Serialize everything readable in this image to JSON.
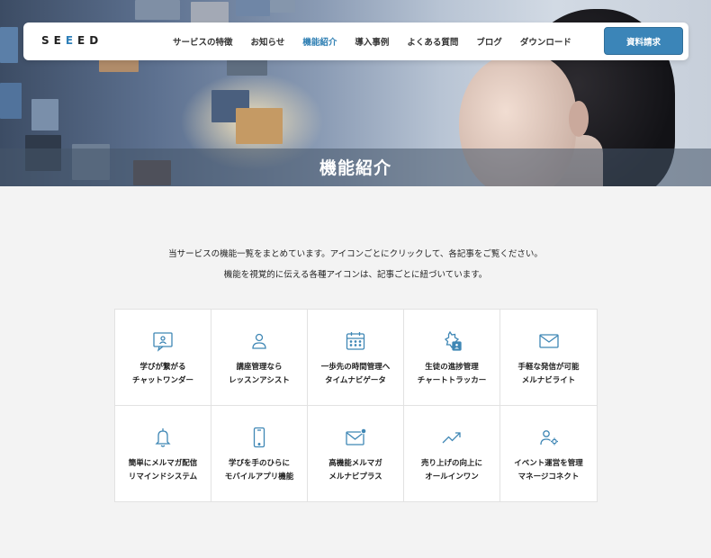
{
  "header": {
    "logo": {
      "pre": "SE",
      "accent": "E",
      "post": "ED"
    },
    "nav": [
      {
        "label": "サービスの特徴"
      },
      {
        "label": "お知らせ"
      },
      {
        "label": "機能紹介"
      },
      {
        "label": "導入事例"
      },
      {
        "label": "よくある質問"
      },
      {
        "label": "ブログ"
      },
      {
        "label": "ダウンロード"
      }
    ],
    "active_nav": "機能紹介",
    "cta_label": "資料請求"
  },
  "hero": {
    "title": "機能紹介"
  },
  "intro": {
    "line1": "当サービスの機能一覧をまとめています。アイコンごとにクリックして、各記事をご覧ください。",
    "line2": "機能を視覚的に伝える各種アイコンは、記事ごとに紐づいています。"
  },
  "features": [
    {
      "line1": "学びが繋がる",
      "line2": "チャットワンダー",
      "icon": "chat-user-icon"
    },
    {
      "line1": "講座管理なら",
      "line2": "レッスンアシスト",
      "icon": "user-icon"
    },
    {
      "line1": "一歩先の時間管理へ",
      "line2": "タイムナビゲータ",
      "icon": "calendar-icon"
    },
    {
      "line1": "生徒の進捗管理",
      "line2": "チャートトラッカー",
      "icon": "progress-badge-icon"
    },
    {
      "line1": "手軽な発信が可能",
      "line2": "メルナビライト",
      "icon": "mail-icon"
    },
    {
      "line1": "簡単にメルマガ配信",
      "line2": "リマインドシステム",
      "icon": "bell-icon"
    },
    {
      "line1": "学びを手のひらに",
      "line2": "モバイルアプリ機能",
      "icon": "smartphone-icon"
    },
    {
      "line1": "高機能メルマガ",
      "line2": "メルナビプラス",
      "icon": "mail-notification-icon"
    },
    {
      "line1": "売り上げの向上に",
      "line2": "オールインワン",
      "icon": "trending-up-icon"
    },
    {
      "line1": "イベント運営を管理",
      "line2": "マネージコネクト",
      "icon": "user-settings-icon"
    }
  ],
  "colors": {
    "accent": "#3b85b8",
    "active_nav": "#2f7fb3",
    "icon_stroke": "#3f87b5",
    "background": "#f3f3f3"
  }
}
